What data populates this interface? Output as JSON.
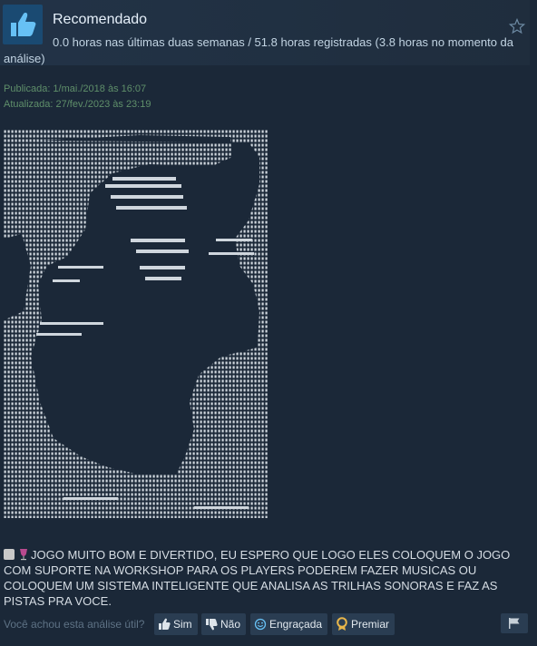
{
  "header": {
    "title": "Recomendado",
    "hours": "0.0 horas nas últimas duas semanas / 51.8 horas registradas (3.8 horas no momento da análise)"
  },
  "dates": {
    "published": "Publicada: 1/mai./2018 às 16:07",
    "updated": "Atualizada: 27/fev./2023 às 23:19"
  },
  "review": {
    "text": "JOGO MUITO BOM E DIVERTIDO, EU ESPERO QUE LOGO ELES COLOQUEM O JOGO COM SUPORTE NA WORKSHOP PARA OS PLAYERS PODEREM FAZER MUSICAS OU COLOQUEM UM SISTEMA INTELIGENTE QUE ANALISA AS TRILHAS SONORAS E FAZ AS PISTAS PRA VOCE."
  },
  "footer": {
    "question": "Você achou esta análise útil?",
    "yes": "Sim",
    "no": "Não",
    "funny": "Engraçada",
    "award": "Premiar"
  },
  "icons": {
    "recommended": "thumbs-up-icon",
    "favorite": "star-icon",
    "scroll": "scroll-icon",
    "wine": "wine-glass-icon",
    "yes": "thumbs-up-icon",
    "no": "thumbs-down-icon",
    "funny": "smiley-icon",
    "award": "award-medal-icon",
    "report": "flag-icon"
  },
  "colors": {
    "background": "#1b2838",
    "header": "#223347",
    "accent_blue": "#67c1f5",
    "date_green": "#5f8f6a",
    "award_gold": "#e8b64a"
  }
}
